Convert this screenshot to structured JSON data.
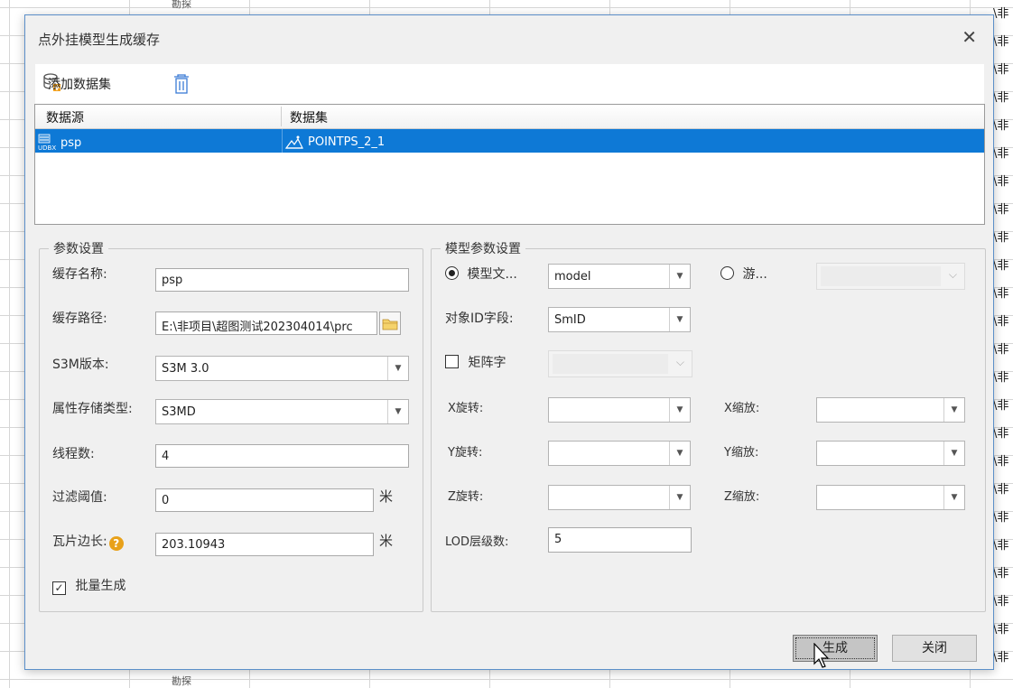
{
  "background": {
    "right_column_cells": [
      "\\非",
      "\\非",
      "\\非",
      "\\非",
      "\\非",
      "\\非",
      "\\非",
      "\\非",
      "\\非",
      "\\非",
      "\\非",
      "\\非",
      "\\非",
      "\\非",
      "\\非",
      "\\非",
      "\\非",
      "\\非",
      "\\非",
      "\\非",
      "\\非",
      "\\非",
      "\\非",
      "\\非"
    ],
    "top_fragment": "勘探",
    "bottom_fragment": "勘探"
  },
  "dialog": {
    "title": "点外挂模型生成缓存",
    "close_symbol": "✕",
    "toolbar": {
      "add_dataset_label": "添加数据集"
    },
    "grid": {
      "columns": [
        "数据源",
        "数据集"
      ],
      "rows": [
        {
          "datasource": "psp",
          "dataset": "POINTPS_2_1"
        }
      ]
    },
    "params": {
      "legend": "参数设置",
      "cache_name_label": "缓存名称:",
      "cache_name_value": "psp",
      "cache_path_label": "缓存路径:",
      "cache_path_value": "E:\\非项目\\超图测试202304014\\prc",
      "s3m_version_label": "S3M版本:",
      "s3m_version_value": "S3M 3.0",
      "attr_storage_label": "属性存储类型:",
      "attr_storage_value": "S3MD",
      "threads_label": "线程数:",
      "threads_value": "4",
      "filter_label": "过滤阈值:",
      "filter_value": "0",
      "filter_unit": "米",
      "tile_edge_label": "瓦片边长:",
      "tile_edge_value": "203.10943",
      "tile_edge_unit": "米",
      "batch_label": "批量生成",
      "batch_checked": true
    },
    "model_params": {
      "legend": "模型参数设置",
      "model_file_radio_label": "模型文...",
      "model_file_value": "model",
      "other_radio_label": "游...",
      "object_id_label": "对象ID字段:",
      "object_id_value": "SmID",
      "matrix_label": "矩阵字",
      "x_rotate_label": "X旋转:",
      "y_rotate_label": "Y旋转:",
      "z_rotate_label": "Z旋转:",
      "x_scale_label": "X缩放:",
      "y_scale_label": "Y缩放:",
      "z_scale_label": "Z缩放:",
      "lod_label": "LOD层级数:",
      "lod_value": "5"
    },
    "buttons": {
      "generate": "生成",
      "close": "关闭"
    }
  }
}
